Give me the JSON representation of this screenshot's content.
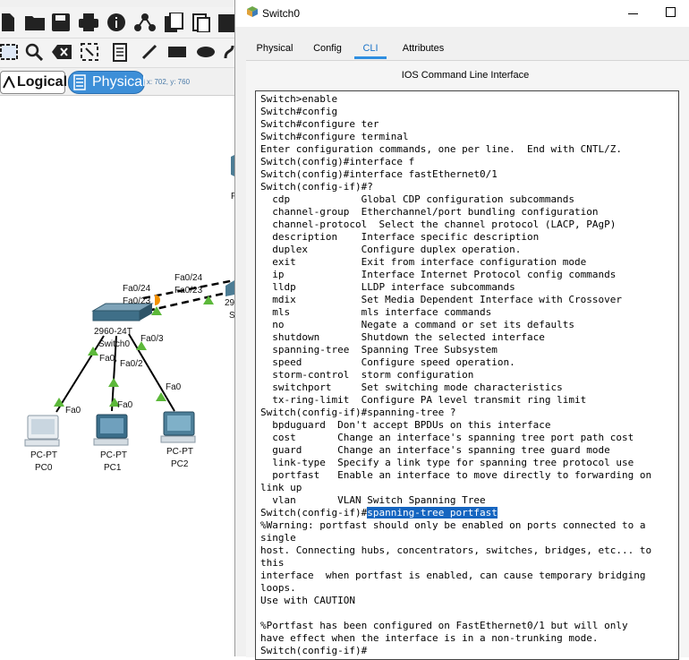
{
  "topology": {
    "mode_tabs": {
      "logical": "Logical",
      "physical": "Physical"
    },
    "coords": "x: 702, y: 760",
    "labels": {
      "switch_label": "Switch0",
      "switch_model": "2960-24T",
      "switch_partial_model": "29",
      "switch_partial_name": "S",
      "partial_device_letter": "P",
      "pc0_type": "PC-PT",
      "pc0_name": "PC0",
      "pc1_type": "PC-PT",
      "pc1_name": "PC1",
      "pc2_type": "PC-PT",
      "pc2_name": "PC2",
      "port_fa024_a": "Fa0/24",
      "port_fa023_a": "Fa0/23",
      "port_fa024_b": "Fa0/24",
      "port_fa023_b": "Fa0/23",
      "port_fa03": "Fa0/3",
      "port_fa02": "Fa0/2",
      "port_fa0_sw": "Fa0,",
      "port_fa0_pc0": "Fa0",
      "port_fa0_pc1": "Fa0",
      "port_fa0_pc2": "Fa0"
    }
  },
  "dialog": {
    "title": "Switch0",
    "tabs": [
      "Physical",
      "Config",
      "CLI",
      "Attributes"
    ],
    "active_tab": "CLI",
    "heading": "IOS Command Line Interface",
    "terminal_before": "Switch>enable\nSwitch#config\nSwitch#configure ter\nSwitch#configure terminal\nEnter configuration commands, one per line.  End with CNTL/Z.\nSwitch(config)#interface f\nSwitch(config)#interface fastEthernet0/1\nSwitch(config-if)#?\n  cdp            Global CDP configuration subcommands\n  channel-group  Etherchannel/port bundling configuration\n  channel-protocol  Select the channel protocol (LACP, PAgP)\n  description    Interface specific description\n  duplex         Configure duplex operation.\n  exit           Exit from interface configuration mode\n  ip             Interface Internet Protocol config commands\n  lldp           LLDP interface subcommands\n  mdix           Set Media Dependent Interface with Crossover\n  mls            mls interface commands\n  no             Negate a command or set its defaults\n  shutdown       Shutdown the selected interface\n  spanning-tree  Spanning Tree Subsystem\n  speed          Configure speed operation.\n  storm-control  storm configuration\n  switchport     Set switching mode characteristics\n  tx-ring-limit  Configure PA level transmit ring limit\nSwitch(config-if)#spanning-tree ?\n  bpduguard  Don't accept BPDUs on this interface\n  cost       Change an interface's spanning tree port path cost\n  guard      Change an interface's spanning tree guard mode\n  link-type  Specify a link type for spanning tree protocol use\n  portfast   Enable an interface to move directly to forwarding on\nlink up\n  vlan       VLAN Switch Spanning Tree\nSwitch(config-if)#",
    "terminal_highlight": "spanning-tree portfast",
    "terminal_after": "\n%Warning: portfast should only be enabled on ports connected to a\nsingle\nhost. Connecting hubs, concentrators, switches, bridges, etc... to\nthis\ninterface  when portfast is enabled, can cause temporary bridging\nloops.\nUse with CAUTION\n\n%Portfast has been configured on FastEthernet0/1 but will only\nhave effect when the interface is in a non-trunking mode.\nSwitch(config-if)#"
  },
  "colors": {
    "link_up": "#5cb83a",
    "link_orange": "#f39200",
    "highlight": "#1565c0",
    "active_tab": "#2f8ee0"
  }
}
